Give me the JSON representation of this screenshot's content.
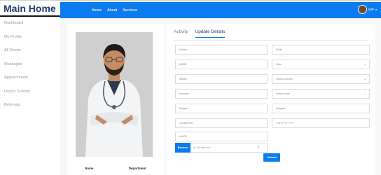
{
  "brand": "Main Home",
  "sidebar": {
    "items": [
      {
        "label": "Dashboard"
      },
      {
        "label": "My Profile"
      },
      {
        "label": "All Doctor"
      },
      {
        "label": "Messages"
      },
      {
        "label": "Appointments"
      },
      {
        "label": "Doctor Summit"
      },
      {
        "label": "Referrals"
      }
    ]
  },
  "navbar": {
    "links": [
      "Home",
      "About",
      "Services"
    ],
    "user": "IMP"
  },
  "profile": {
    "name_label": "Name",
    "department_label": "Department"
  },
  "tabs": [
    "Activity",
    "Update Details"
  ],
  "form": {
    "first_name": "Adrian",
    "last_name": "Elijah",
    "age": "MBBS",
    "gender": "Male",
    "qualification": "MBBS",
    "country": "Select country",
    "specialty": "Eyecare",
    "state": "Select state",
    "city": "Raigarh",
    "area": "Raigarh",
    "phone": "123456789",
    "mobile": "+91777777777",
    "pin": "A4623",
    "browse_label": "Browse",
    "file_placeholder": "no file selected",
    "submit_label": "Submit"
  },
  "colors": {
    "primary": "#0b7bf0",
    "brand_text": "#1c3b70"
  }
}
